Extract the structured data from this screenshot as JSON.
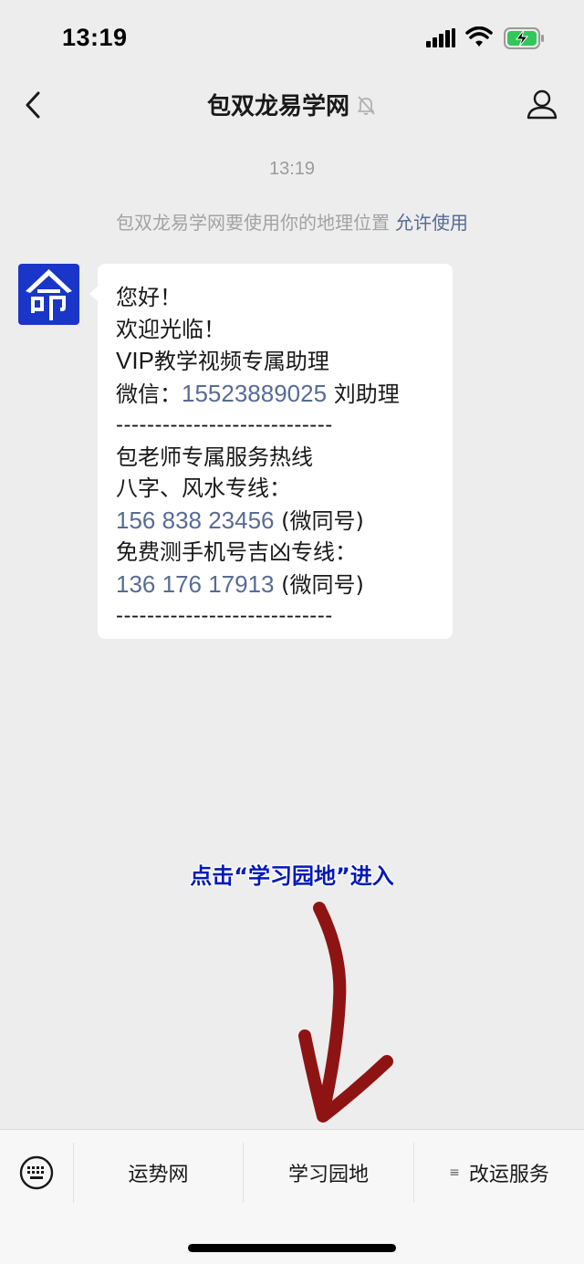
{
  "status_bar": {
    "time": "13:19"
  },
  "nav": {
    "title": "包双龙易学网"
  },
  "chat": {
    "timestamp": "13:19",
    "system_message": "包双龙易学网要使用你的地理位置",
    "system_action": "允许使用",
    "avatar_glyph": "命",
    "message": {
      "line1": "您好！",
      "line2": "欢迎光临！",
      "line3_latin": "VIP",
      "line3_rest": "教学视频专属助理",
      "wechat_label": "微信：",
      "wechat_number": "15523889025",
      "wechat_suffix": " 刘助理",
      "divider": "----------------------------",
      "hotline_title": "包老师专属服务热线",
      "fengshui_label": "八字、风水专线：",
      "fengshui_number": "156 838 23456",
      "fengshui_suffix": " (微同号)",
      "phone_test_label": "免费测手机号吉凶专线：",
      "phone_test_number": "136 176  17913",
      "phone_test_suffix": " (微同号)",
      "divider2": "----------------------------"
    }
  },
  "annotation": {
    "text": "点击“学习园地”进入"
  },
  "bottom_menu": {
    "items": [
      {
        "label": "运势网"
      },
      {
        "label": "学习园地"
      },
      {
        "label": "改运服务",
        "icon": "≡"
      }
    ]
  },
  "colors": {
    "background": "#ededed",
    "link": "#576b95",
    "avatar": "#1a36c9",
    "annotation": "#0019b8",
    "arrow": "#8e1414"
  }
}
